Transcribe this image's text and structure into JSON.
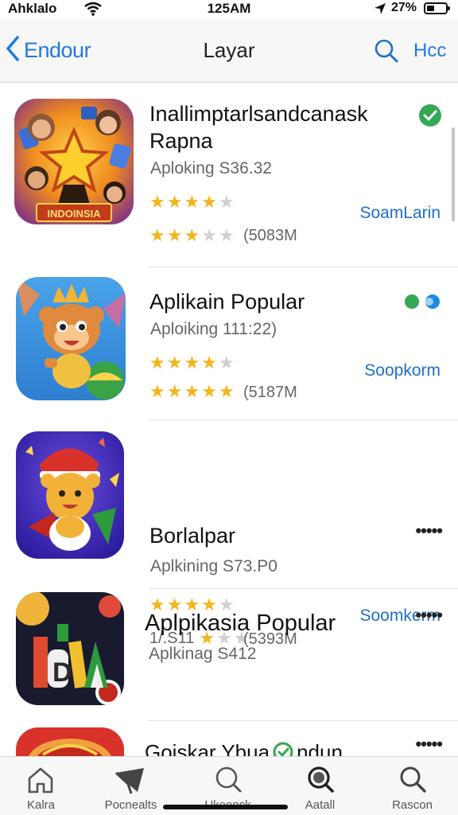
{
  "status_bar": {
    "carrier": "Ahklalo",
    "time": "125AM",
    "battery": "27%"
  },
  "nav": {
    "back_label": "Endour",
    "title": "Layar",
    "right_label": "Hcc"
  },
  "apps": [
    {
      "name_line1": "Inallimptarlsandcanask",
      "name_line2": "Rapna",
      "subtitle": "Aploking S36.32",
      "action": "SoamLarin",
      "meta": "(5083M",
      "rating": 4,
      "rating2": 3,
      "badge_icon": "green-check-icon"
    },
    {
      "name_line1": "Aplikain Popular",
      "subtitle": "Aploiking 111:22)",
      "action": "Soopkorm",
      "meta": "(5187M",
      "rating": 4,
      "rating2": 5,
      "badge_icon": "green-blue-dots-icon"
    },
    {
      "name_line1": "Borlalpar",
      "subtitle": "Aplkining S73.P0",
      "action": "Soomkerm",
      "meta": "(5393M",
      "stars_prefix": "1/.S11",
      "rating": 4,
      "rating2": 1,
      "badge_icon": "blue-verified-icon",
      "more": "•••••"
    },
    {
      "name_line1": "Aplpikasia Popular",
      "subtitle": "Aplkinag S412",
      "rating": 3,
      "more": "•••••"
    },
    {
      "name_line1": "Goiskar Ybua",
      "name_line1b": "ndun",
      "more": "•••••"
    }
  ],
  "tabs": [
    {
      "label": "Kalra",
      "icon": "home-icon"
    },
    {
      "label": "Pocnealts",
      "icon": "tag-icon"
    },
    {
      "label": "Ukeonck",
      "icon": "search-icon"
    },
    {
      "label": "Aatall",
      "icon": "search-active-icon"
    },
    {
      "label": "Rascon",
      "icon": "search-icon"
    }
  ],
  "colors": {
    "accent": "#1f7ae0",
    "star": "#f3b51c",
    "verified_green": "#34a853",
    "verified_blue": "#1e88e5"
  }
}
